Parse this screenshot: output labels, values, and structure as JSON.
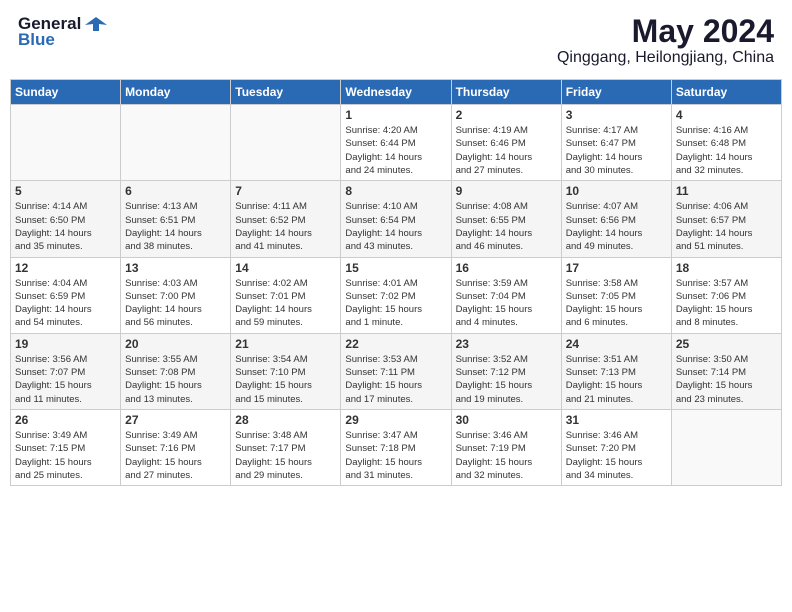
{
  "logo": {
    "general": "General",
    "blue": "Blue"
  },
  "title": {
    "month": "May 2024",
    "location": "Qinggang, Heilongjiang, China"
  },
  "days_header": [
    "Sunday",
    "Monday",
    "Tuesday",
    "Wednesday",
    "Thursday",
    "Friday",
    "Saturday"
  ],
  "weeks": [
    [
      {
        "day": "",
        "info": ""
      },
      {
        "day": "",
        "info": ""
      },
      {
        "day": "",
        "info": ""
      },
      {
        "day": "1",
        "info": "Sunrise: 4:20 AM\nSunset: 6:44 PM\nDaylight: 14 hours\nand 24 minutes."
      },
      {
        "day": "2",
        "info": "Sunrise: 4:19 AM\nSunset: 6:46 PM\nDaylight: 14 hours\nand 27 minutes."
      },
      {
        "day": "3",
        "info": "Sunrise: 4:17 AM\nSunset: 6:47 PM\nDaylight: 14 hours\nand 30 minutes."
      },
      {
        "day": "4",
        "info": "Sunrise: 4:16 AM\nSunset: 6:48 PM\nDaylight: 14 hours\nand 32 minutes."
      }
    ],
    [
      {
        "day": "5",
        "info": "Sunrise: 4:14 AM\nSunset: 6:50 PM\nDaylight: 14 hours\nand 35 minutes."
      },
      {
        "day": "6",
        "info": "Sunrise: 4:13 AM\nSunset: 6:51 PM\nDaylight: 14 hours\nand 38 minutes."
      },
      {
        "day": "7",
        "info": "Sunrise: 4:11 AM\nSunset: 6:52 PM\nDaylight: 14 hours\nand 41 minutes."
      },
      {
        "day": "8",
        "info": "Sunrise: 4:10 AM\nSunset: 6:54 PM\nDaylight: 14 hours\nand 43 minutes."
      },
      {
        "day": "9",
        "info": "Sunrise: 4:08 AM\nSunset: 6:55 PM\nDaylight: 14 hours\nand 46 minutes."
      },
      {
        "day": "10",
        "info": "Sunrise: 4:07 AM\nSunset: 6:56 PM\nDaylight: 14 hours\nand 49 minutes."
      },
      {
        "day": "11",
        "info": "Sunrise: 4:06 AM\nSunset: 6:57 PM\nDaylight: 14 hours\nand 51 minutes."
      }
    ],
    [
      {
        "day": "12",
        "info": "Sunrise: 4:04 AM\nSunset: 6:59 PM\nDaylight: 14 hours\nand 54 minutes."
      },
      {
        "day": "13",
        "info": "Sunrise: 4:03 AM\nSunset: 7:00 PM\nDaylight: 14 hours\nand 56 minutes."
      },
      {
        "day": "14",
        "info": "Sunrise: 4:02 AM\nSunset: 7:01 PM\nDaylight: 14 hours\nand 59 minutes."
      },
      {
        "day": "15",
        "info": "Sunrise: 4:01 AM\nSunset: 7:02 PM\nDaylight: 15 hours\nand 1 minute."
      },
      {
        "day": "16",
        "info": "Sunrise: 3:59 AM\nSunset: 7:04 PM\nDaylight: 15 hours\nand 4 minutes."
      },
      {
        "day": "17",
        "info": "Sunrise: 3:58 AM\nSunset: 7:05 PM\nDaylight: 15 hours\nand 6 minutes."
      },
      {
        "day": "18",
        "info": "Sunrise: 3:57 AM\nSunset: 7:06 PM\nDaylight: 15 hours\nand 8 minutes."
      }
    ],
    [
      {
        "day": "19",
        "info": "Sunrise: 3:56 AM\nSunset: 7:07 PM\nDaylight: 15 hours\nand 11 minutes."
      },
      {
        "day": "20",
        "info": "Sunrise: 3:55 AM\nSunset: 7:08 PM\nDaylight: 15 hours\nand 13 minutes."
      },
      {
        "day": "21",
        "info": "Sunrise: 3:54 AM\nSunset: 7:10 PM\nDaylight: 15 hours\nand 15 minutes."
      },
      {
        "day": "22",
        "info": "Sunrise: 3:53 AM\nSunset: 7:11 PM\nDaylight: 15 hours\nand 17 minutes."
      },
      {
        "day": "23",
        "info": "Sunrise: 3:52 AM\nSunset: 7:12 PM\nDaylight: 15 hours\nand 19 minutes."
      },
      {
        "day": "24",
        "info": "Sunrise: 3:51 AM\nSunset: 7:13 PM\nDaylight: 15 hours\nand 21 minutes."
      },
      {
        "day": "25",
        "info": "Sunrise: 3:50 AM\nSunset: 7:14 PM\nDaylight: 15 hours\nand 23 minutes."
      }
    ],
    [
      {
        "day": "26",
        "info": "Sunrise: 3:49 AM\nSunset: 7:15 PM\nDaylight: 15 hours\nand 25 minutes."
      },
      {
        "day": "27",
        "info": "Sunrise: 3:49 AM\nSunset: 7:16 PM\nDaylight: 15 hours\nand 27 minutes."
      },
      {
        "day": "28",
        "info": "Sunrise: 3:48 AM\nSunset: 7:17 PM\nDaylight: 15 hours\nand 29 minutes."
      },
      {
        "day": "29",
        "info": "Sunrise: 3:47 AM\nSunset: 7:18 PM\nDaylight: 15 hours\nand 31 minutes."
      },
      {
        "day": "30",
        "info": "Sunrise: 3:46 AM\nSunset: 7:19 PM\nDaylight: 15 hours\nand 32 minutes."
      },
      {
        "day": "31",
        "info": "Sunrise: 3:46 AM\nSunset: 7:20 PM\nDaylight: 15 hours\nand 34 minutes."
      },
      {
        "day": "",
        "info": ""
      }
    ]
  ]
}
